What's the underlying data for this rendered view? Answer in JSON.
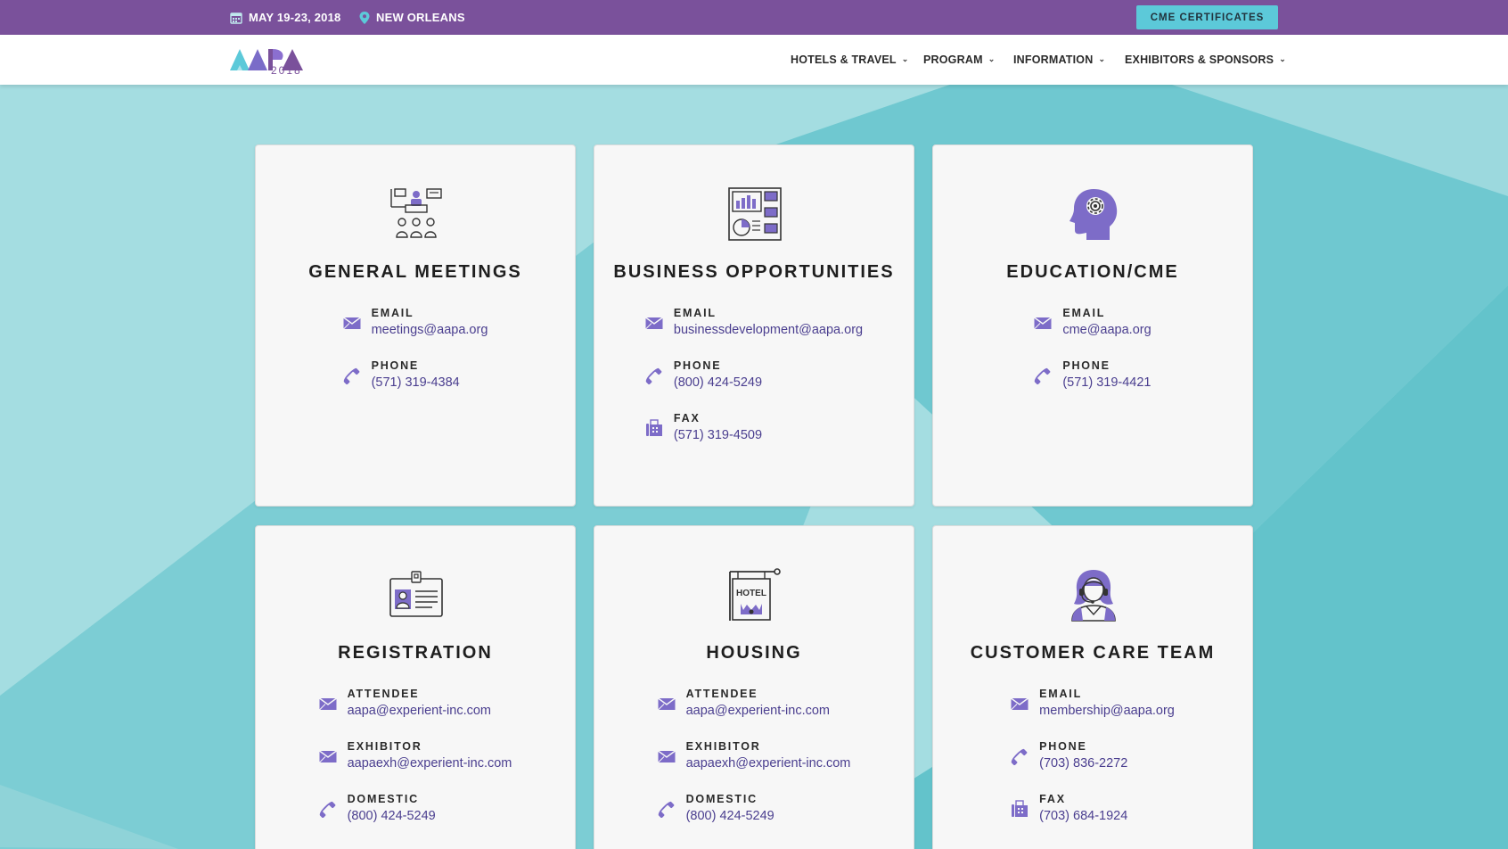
{
  "topbar": {
    "date": "MAY 19-23, 2018",
    "location": "NEW ORLEANS",
    "cme_button": "CME CERTIFICATES"
  },
  "logo": {
    "text": "AAPA",
    "year": "2018"
  },
  "nav": {
    "items": [
      {
        "label": "HOTELS & TRAVEL"
      },
      {
        "label": "PROGRAM"
      },
      {
        "label": "INFORMATION"
      },
      {
        "label": "EXHIBITORS & SPONSORS"
      }
    ]
  },
  "icons": {
    "calendar": "calendar-icon",
    "location": "map-pin-icon",
    "chevron": "chevron-down-icon",
    "email": "envelope-icon",
    "phone": "phone-icon",
    "fax": "fax-icon"
  },
  "colors": {
    "brand_purple": "#7a519b",
    "accent_teal": "#5cc9d9",
    "link_purple": "#4a3e8f",
    "icon_purple": "#7d6cc8"
  },
  "cards": [
    {
      "title": "GENERAL MEETINGS",
      "icon": "presenter-audience-icon",
      "contacts": [
        {
          "label": "EMAIL",
          "value": "meetings@aapa.org",
          "icon": "envelope-icon"
        },
        {
          "label": "PHONE",
          "value": "(571) 319-4384",
          "icon": "phone-icon"
        }
      ]
    },
    {
      "title": "BUSINESS OPPORTUNITIES",
      "icon": "business-dashboard-icon",
      "contacts": [
        {
          "label": "EMAIL",
          "value": "businessdevelopment@aapa.org",
          "icon": "envelope-icon"
        },
        {
          "label": "PHONE",
          "value": "(800) 424-5249",
          "icon": "phone-icon"
        },
        {
          "label": "FAX",
          "value": "(571) 319-4509",
          "icon": "fax-icon"
        }
      ]
    },
    {
      "title": "EDUCATION/CME",
      "icon": "head-gear-icon",
      "contacts": [
        {
          "label": "EMAIL",
          "value": "cme@aapa.org",
          "icon": "envelope-icon"
        },
        {
          "label": "PHONE",
          "value": "(571) 319-4421",
          "icon": "phone-icon"
        }
      ]
    },
    {
      "title": "REGISTRATION",
      "icon": "id-badge-icon",
      "contacts": [
        {
          "label": "ATTENDEE",
          "value": "aapa@experient-inc.com",
          "icon": "envelope-icon"
        },
        {
          "label": "EXHIBITOR",
          "value": "aapaexh@experient-inc.com",
          "icon": "envelope-icon"
        },
        {
          "label": "DOMESTIC",
          "value": "(800) 424-5249",
          "icon": "phone-icon"
        }
      ]
    },
    {
      "title": "HOUSING",
      "icon": "hotel-sign-icon",
      "icon_text": "HOTEL",
      "contacts": [
        {
          "label": "ATTENDEE",
          "value": "aapa@experient-inc.com",
          "icon": "envelope-icon"
        },
        {
          "label": "EXHIBITOR",
          "value": "aapaexh@experient-inc.com",
          "icon": "envelope-icon"
        },
        {
          "label": "DOMESTIC",
          "value": "(800) 424-5249",
          "icon": "phone-icon"
        }
      ]
    },
    {
      "title": "CUSTOMER CARE TEAM",
      "icon": "headset-agent-icon",
      "contacts": [
        {
          "label": "EMAIL",
          "value": "membership@aapa.org",
          "icon": "envelope-icon"
        },
        {
          "label": "PHONE",
          "value": "(703) 836-2272",
          "icon": "phone-icon"
        },
        {
          "label": "FAX",
          "value": "(703) 684-1924",
          "icon": "fax-icon"
        }
      ]
    }
  ]
}
